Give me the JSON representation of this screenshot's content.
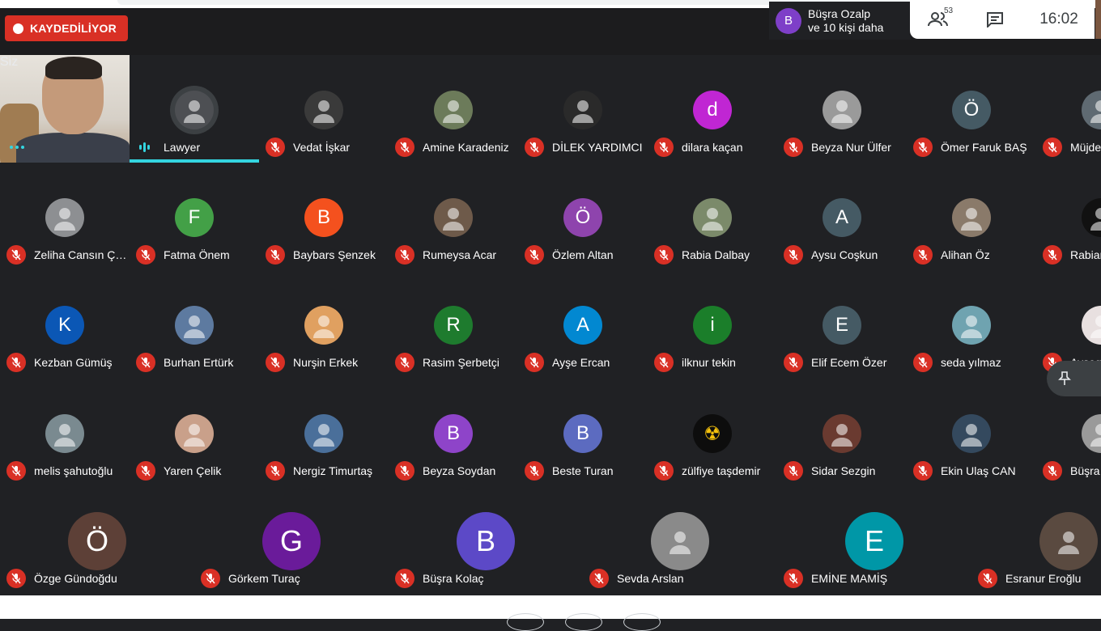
{
  "recording_label": "KAYDEDİLİYOR",
  "notification": {
    "avatar_letter": "B",
    "line1": "Büşra Ozalp",
    "line2": "ve 10 kişi daha",
    "color": "#7e3fc8"
  },
  "participant_count": "53",
  "clock": "16:02",
  "icons": {
    "people": "people-icon",
    "chat": "chat-icon",
    "mic_off": "mic-off-icon",
    "pin": "pin-icon"
  },
  "self_name": "Siz",
  "rows": [
    [
      {
        "name": "Lawyer",
        "avatar": "",
        "color": "#4d4f53",
        "speaking": true
      },
      {
        "name": "Vedat İşkar",
        "avatar": "",
        "color": "#3a3a3a"
      },
      {
        "name": "Amine Karadeniz",
        "avatar": "",
        "color": "#6c7b5a"
      },
      {
        "name": "DİLEK YARDIMCI",
        "avatar": "",
        "color": "#2a2a2a"
      },
      {
        "name": "dilara kaçan",
        "avatar": "d",
        "color": "#c026d3"
      },
      {
        "name": "Beyza Nur Ülfer",
        "avatar": "",
        "color": "#9a9a9a"
      },
      {
        "name": "Ömer Faruk BAŞ",
        "avatar": "Ö",
        "color": "#455a64"
      },
      {
        "name": "Müjde",
        "avatar": "",
        "color": "#5f6a72"
      }
    ],
    [
      {
        "name": "Zeliha Cansın Ç…",
        "avatar": "",
        "color": "#8d8f92"
      },
      {
        "name": "Fatma Önem",
        "avatar": "F",
        "color": "#43a047"
      },
      {
        "name": "Baybars Şenzek",
        "avatar": "B",
        "color": "#f4511e"
      },
      {
        "name": "Rumeysa Acar",
        "avatar": "",
        "color": "#6e5a4a"
      },
      {
        "name": "Özlem Altan",
        "avatar": "Ö",
        "color": "#8e44ad"
      },
      {
        "name": "Rabia Dalbay",
        "avatar": "",
        "color": "#7b8a6a"
      },
      {
        "name": "Aysu Coşkun",
        "avatar": "A",
        "color": "#455a64"
      },
      {
        "name": "Alihan Öz",
        "avatar": "",
        "color": "#8a7a6a"
      },
      {
        "name": "Rabian",
        "avatar": "",
        "color": "#111111"
      }
    ],
    [
      {
        "name": "Kezban Gümüş",
        "avatar": "K",
        "color": "#0b57b5"
      },
      {
        "name": "Burhan Ertürk",
        "avatar": "",
        "color": "#5d7aa0"
      },
      {
        "name": "Nurşin Erkek",
        "avatar": "",
        "color": "#e0a060"
      },
      {
        "name": "Rasim Şerbetçi",
        "avatar": "R",
        "color": "#1e7b2e"
      },
      {
        "name": "Ayşe Ercan",
        "avatar": "A",
        "color": "#0288d1"
      },
      {
        "name": "ilknur tekin",
        "avatar": "i",
        "color": "#1b7e2a"
      },
      {
        "name": "Elif Ecem Özer",
        "avatar": "E",
        "color": "#455a64"
      },
      {
        "name": "seda yılmaz",
        "avatar": "",
        "color": "#6fa3b0"
      },
      {
        "name": "Ayşeg",
        "avatar": "",
        "color": "#e8e0e0"
      }
    ],
    [
      {
        "name": "melis şahutoğlu",
        "avatar": "",
        "color": "#7a8a90"
      },
      {
        "name": "Yaren Çelik",
        "avatar": "",
        "color": "#c9a08a"
      },
      {
        "name": "Nergiz Timurtaş",
        "avatar": "",
        "color": "#4a6f9a"
      },
      {
        "name": "Beyza Soydan",
        "avatar": "B",
        "color": "#8e44c9"
      },
      {
        "name": "Beste Turan",
        "avatar": "B",
        "color": "#5c6bc0"
      },
      {
        "name": "zülfiye taşdemir",
        "avatar": "☢",
        "color": "#0d0d0d"
      },
      {
        "name": "Sidar Sezgin",
        "avatar": "",
        "color": "#6a3a30"
      },
      {
        "name": "Ekin Ulaş CAN",
        "avatar": "",
        "color": "#34495e"
      },
      {
        "name": "Büşra",
        "avatar": "",
        "color": "#9a9a9a"
      }
    ],
    [
      {
        "name": "Özge Gündoğdu",
        "avatar": "Ö",
        "color": "#5d4037"
      },
      {
        "name": "Görkem Turaç",
        "avatar": "G",
        "color": "#6a1b9a"
      },
      {
        "name": "Büşra Kolaç",
        "avatar": "B",
        "color": "#5c49c7"
      },
      {
        "name": "Sevda Arslan",
        "avatar": "",
        "color": "#8a8a8a"
      },
      {
        "name": "EMİNE MAMİŞ",
        "avatar": "E",
        "color": "#0097a7"
      },
      {
        "name": "Esranur Eroğlu",
        "avatar": "",
        "color": "#5a4a40"
      }
    ]
  ]
}
